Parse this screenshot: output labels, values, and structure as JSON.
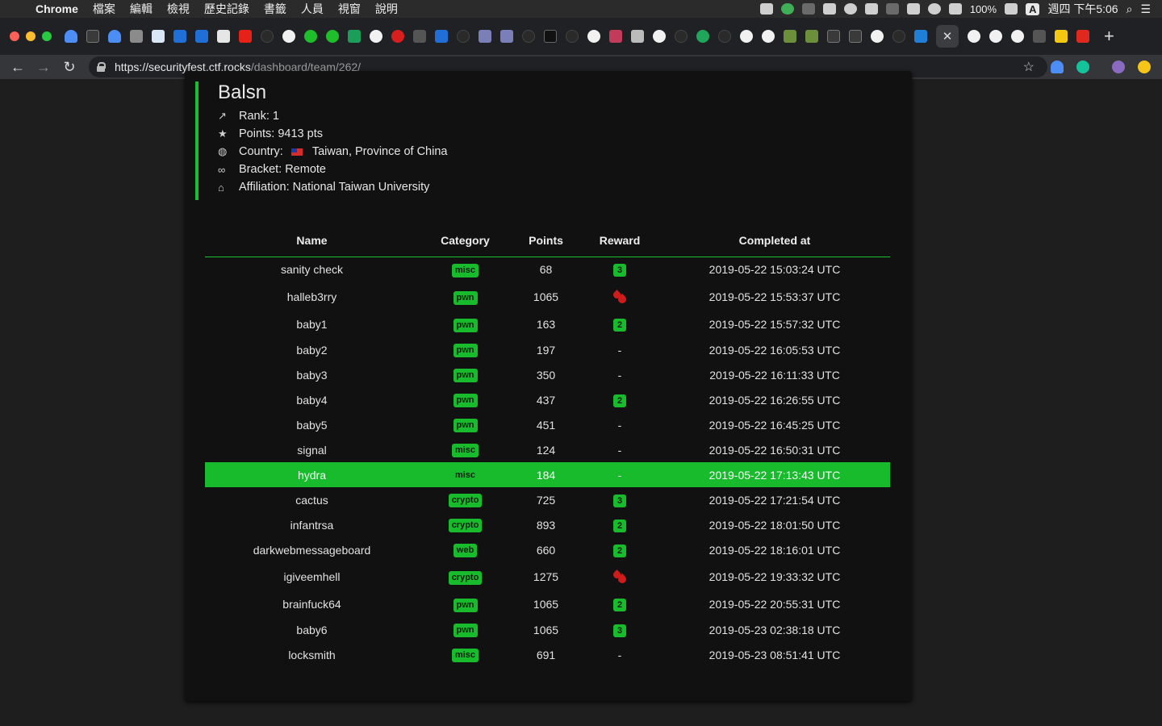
{
  "menubar": {
    "app": "Chrome",
    "menus": [
      "檔案",
      "編輯",
      "檢視",
      "歷史記錄",
      "書籤",
      "人員",
      "視窗",
      "說明"
    ],
    "battery": "100%",
    "input_method": "A",
    "clock": "週四 下午5:06"
  },
  "browser": {
    "url_host": "https://securityfest.ctf.rocks",
    "url_path": "/dashboard/team/262/",
    "new_tab": "+",
    "close_tab": "✕"
  },
  "team": {
    "name": "Balsn",
    "rank": "Rank: 1",
    "points": "Points: 9413 pts",
    "country_label": "Country:",
    "country": "Taiwan, Province of China",
    "bracket": "Bracket: Remote",
    "affiliation": "Affiliation: National Taiwan University"
  },
  "table": {
    "headers": [
      "Name",
      "Category",
      "Points",
      "Reward",
      "Completed at"
    ],
    "rows": [
      {
        "name": "sanity check",
        "category": "misc",
        "points": "68",
        "reward": "3",
        "completed": "2019-05-22 15:03:24 UTC"
      },
      {
        "name": "halleb3rry",
        "category": "pwn",
        "points": "1065",
        "reward": "blood",
        "completed": "2019-05-22 15:53:37 UTC"
      },
      {
        "name": "baby1",
        "category": "pwn",
        "points": "163",
        "reward": "2",
        "completed": "2019-05-22 15:57:32 UTC"
      },
      {
        "name": "baby2",
        "category": "pwn",
        "points": "197",
        "reward": "-",
        "completed": "2019-05-22 16:05:53 UTC"
      },
      {
        "name": "baby3",
        "category": "pwn",
        "points": "350",
        "reward": "-",
        "completed": "2019-05-22 16:11:33 UTC"
      },
      {
        "name": "baby4",
        "category": "pwn",
        "points": "437",
        "reward": "2",
        "completed": "2019-05-22 16:26:55 UTC"
      },
      {
        "name": "baby5",
        "category": "pwn",
        "points": "451",
        "reward": "-",
        "completed": "2019-05-22 16:45:25 UTC"
      },
      {
        "name": "signal",
        "category": "misc",
        "points": "124",
        "reward": "-",
        "completed": "2019-05-22 16:50:31 UTC"
      },
      {
        "name": "hydra",
        "category": "misc",
        "points": "184",
        "reward": "-",
        "completed": "2019-05-22 17:13:43 UTC",
        "highlight": true
      },
      {
        "name": "cactus",
        "category": "crypto",
        "points": "725",
        "reward": "3",
        "completed": "2019-05-22 17:21:54 UTC"
      },
      {
        "name": "infantrsa",
        "category": "crypto",
        "points": "893",
        "reward": "2",
        "completed": "2019-05-22 18:01:50 UTC"
      },
      {
        "name": "darkwebmessageboard",
        "category": "web",
        "points": "660",
        "reward": "2",
        "completed": "2019-05-22 18:16:01 UTC"
      },
      {
        "name": "igiveemhell",
        "category": "crypto",
        "points": "1275",
        "reward": "blood",
        "completed": "2019-05-22 19:33:32 UTC"
      },
      {
        "name": "brainfuck64",
        "category": "pwn",
        "points": "1065",
        "reward": "2",
        "completed": "2019-05-22 20:55:31 UTC"
      },
      {
        "name": "baby6",
        "category": "pwn",
        "points": "1065",
        "reward": "3",
        "completed": "2019-05-23 02:38:18 UTC"
      },
      {
        "name": "locksmith",
        "category": "misc",
        "points": "691",
        "reward": "-",
        "completed": "2019-05-23 08:51:41 UTC"
      }
    ]
  },
  "colors": {
    "accent": "#17bb2c",
    "first_blood": "#d01b1b",
    "card_bg": "#111111",
    "page_bg": "#1e1e1e"
  },
  "icons": {
    "rank": "trending-up-icon",
    "points": "star-icon",
    "country": "globe-icon",
    "bracket": "link-icon",
    "affiliation": "home-icon",
    "first_blood": "blood-drop-icon"
  }
}
